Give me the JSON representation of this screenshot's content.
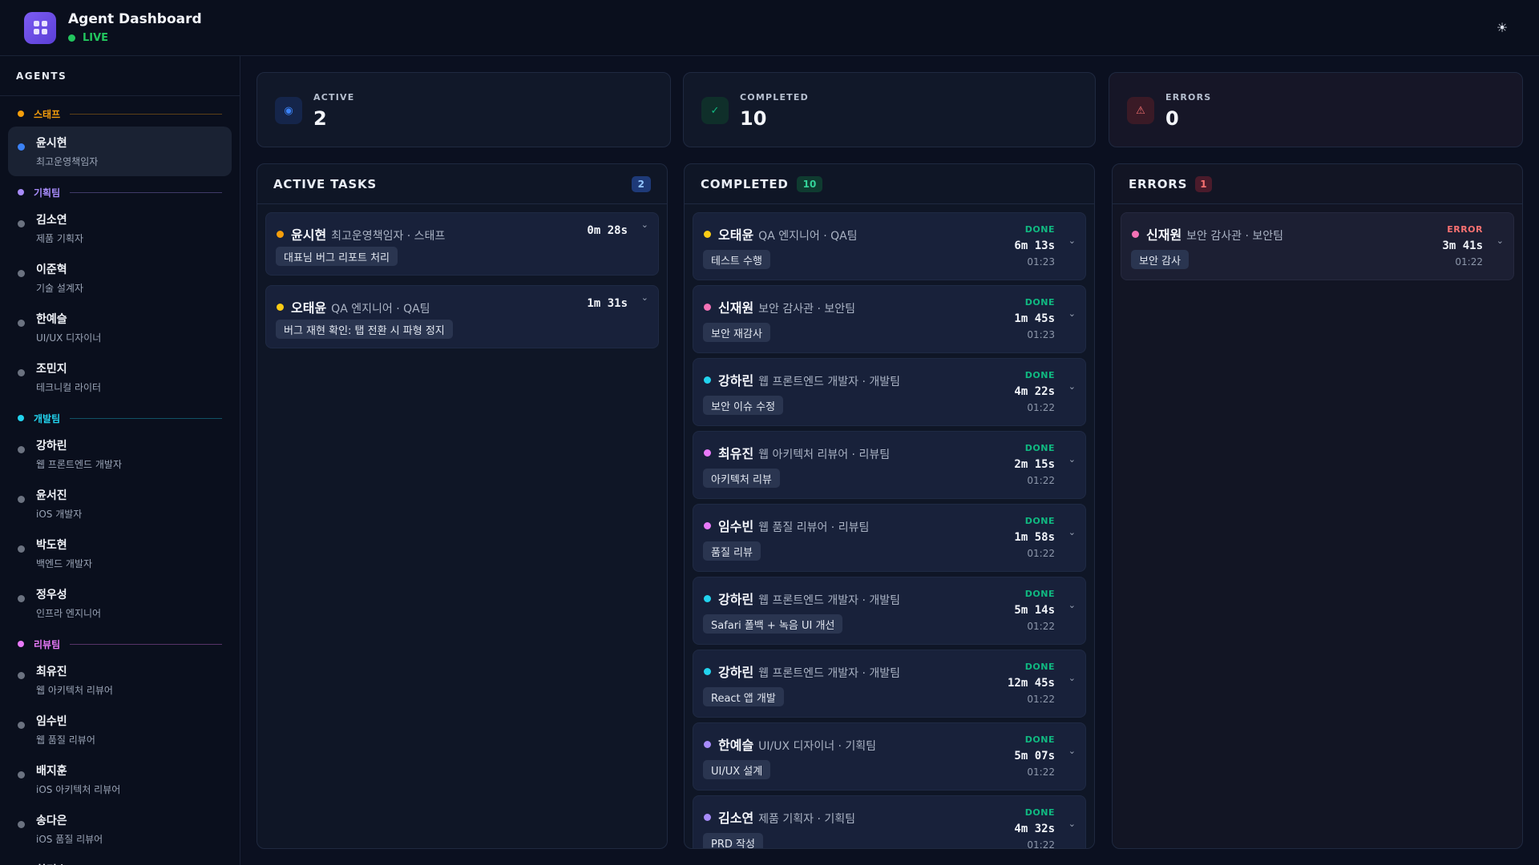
{
  "app": {
    "title": "Agent Dashboard",
    "status": "LIVE",
    "theme_icon": "sun-icon"
  },
  "sidebar": {
    "heading": "AGENTS",
    "groups": [
      {
        "label": "스태프",
        "color": "#f59e0b",
        "agents": [
          {
            "name": "윤시현",
            "role": "최고운영책임자",
            "dot": "#3b82f6",
            "selected": true
          }
        ]
      },
      {
        "label": "기획팀",
        "color": "#a78bfa",
        "agents": [
          {
            "name": "김소연",
            "role": "제품 기획자",
            "dot": "#6b7280"
          },
          {
            "name": "이준혁",
            "role": "기술 설계자",
            "dot": "#6b7280"
          },
          {
            "name": "한예슬",
            "role": "UI/UX 디자이너",
            "dot": "#6b7280"
          },
          {
            "name": "조민지",
            "role": "테크니컬 라이터",
            "dot": "#6b7280"
          }
        ]
      },
      {
        "label": "개발팀",
        "color": "#22d3ee",
        "agents": [
          {
            "name": "강하린",
            "role": "웹 프론트엔드 개발자",
            "dot": "#6b7280"
          },
          {
            "name": "윤서진",
            "role": "iOS 개발자",
            "dot": "#6b7280"
          },
          {
            "name": "박도현",
            "role": "백엔드 개발자",
            "dot": "#6b7280"
          },
          {
            "name": "정우성",
            "role": "인프라 엔지니어",
            "dot": "#6b7280"
          }
        ]
      },
      {
        "label": "리뷰팀",
        "color": "#e879f9",
        "agents": [
          {
            "name": "최유진",
            "role": "웹 아키텍처 리뷰어",
            "dot": "#6b7280"
          },
          {
            "name": "임수빈",
            "role": "웹 품질 리뷰어",
            "dot": "#6b7280"
          },
          {
            "name": "배지훈",
            "role": "iOS 아키텍처 리뷰어",
            "dot": "#6b7280"
          },
          {
            "name": "송다은",
            "role": "iOS 품질 리뷰어",
            "dot": "#6b7280"
          },
          {
            "name": "한민호",
            "role": "",
            "dot": "#6b7280"
          }
        ]
      }
    ]
  },
  "stats": {
    "active": {
      "label": "ACTIVE",
      "value": "2",
      "icon": "active-dot-icon"
    },
    "completed": {
      "label": "COMPLETED",
      "value": "10",
      "icon": "check-icon"
    },
    "errors": {
      "label": "ERRORS",
      "value": "0",
      "icon": "warning-triangle-icon"
    }
  },
  "columns": {
    "active": {
      "title": "ACTIVE TASKS",
      "badge": "2",
      "tasks": [
        {
          "name": "윤시현",
          "role": "최고운영책임자 · 스태프",
          "task": "대표님 버그 리포트 처리",
          "time": "0m 28s",
          "dot": "#f59e0b"
        },
        {
          "name": "오태윤",
          "role": "QA 엔지니어 · QA팀",
          "task": "버그 재현 확인: 탭 전환 시 파형 정지",
          "time": "1m 31s",
          "dot": "#facc15"
        }
      ]
    },
    "completed": {
      "title": "COMPLETED",
      "badge": "10",
      "tasks": [
        {
          "name": "오태윤",
          "role": "QA 엔지니어 · QA팀",
          "task": "테스트 수행",
          "status": "DONE",
          "time": "6m 13s",
          "stamp": "01:23",
          "dot": "#facc15"
        },
        {
          "name": "신재원",
          "role": "보안 감사관 · 보안팀",
          "task": "보안 재감사",
          "status": "DONE",
          "time": "1m 45s",
          "stamp": "01:23",
          "dot": "#f472b6"
        },
        {
          "name": "강하린",
          "role": "웹 프론트엔드 개발자 · 개발팀",
          "task": "보안 이슈 수정",
          "status": "DONE",
          "time": "4m 22s",
          "stamp": "01:22",
          "dot": "#22d3ee"
        },
        {
          "name": "최유진",
          "role": "웹 아키텍처 리뷰어 · 리뷰팀",
          "task": "아키텍처 리뷰",
          "status": "DONE",
          "time": "2m 15s",
          "stamp": "01:22",
          "dot": "#e879f9"
        },
        {
          "name": "임수빈",
          "role": "웹 품질 리뷰어 · 리뷰팀",
          "task": "품질 리뷰",
          "status": "DONE",
          "time": "1m 58s",
          "stamp": "01:22",
          "dot": "#e879f9"
        },
        {
          "name": "강하린",
          "role": "웹 프론트엔드 개발자 · 개발팀",
          "task": "Safari 폴백 + 녹음 UI 개선",
          "status": "DONE",
          "time": "5m 14s",
          "stamp": "01:22",
          "dot": "#22d3ee"
        },
        {
          "name": "강하린",
          "role": "웹 프론트엔드 개발자 · 개발팀",
          "task": "React 앱 개발",
          "status": "DONE",
          "time": "12m 45s",
          "stamp": "01:22",
          "dot": "#22d3ee"
        },
        {
          "name": "한예슬",
          "role": "UI/UX 디자이너 · 기획팀",
          "task": "UI/UX 설계",
          "status": "DONE",
          "time": "5m 07s",
          "stamp": "01:22",
          "dot": "#a78bfa"
        },
        {
          "name": "김소연",
          "role": "제품 기획자 · 기획팀",
          "task": "PRD 작성",
          "status": "DONE",
          "time": "4m 32s",
          "stamp": "01:22",
          "dot": "#a78bfa"
        }
      ]
    },
    "errors": {
      "title": "ERRORS",
      "badge": "1",
      "tasks": [
        {
          "name": "신재원",
          "role": "보안 감사관 · 보안팀",
          "task": "보안 감사",
          "status": "ERROR",
          "time": "3m 41s",
          "stamp": "01:22",
          "dot": "#f472b6"
        }
      ]
    }
  },
  "colors": {
    "done": "#10b981",
    "error": "#f87171",
    "accent": "#7c5cf2",
    "live": "#22c55e"
  }
}
